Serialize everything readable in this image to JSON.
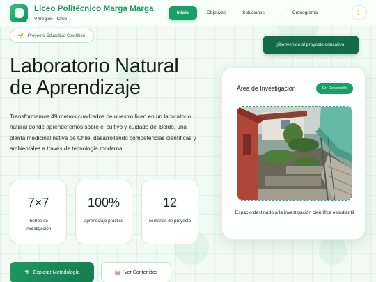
{
  "brand": {
    "title": "Liceo Politécnico Marga Marga",
    "subtitle": "V Región - Chile"
  },
  "nav": {
    "items": [
      "Inicio",
      "Objetivos",
      "Soluciones",
      "Cronograma"
    ],
    "active": "Inicio"
  },
  "theme_toggle_icon": "moon-icon",
  "badge": {
    "label": "Proyecto Educativo Científico",
    "icon": "sprout-icon"
  },
  "welcome": {
    "label": "¡Bienvenido al proyecto educativo!"
  },
  "hero": {
    "title_line1": "Laboratorio Natural",
    "title_line2": "de Aprendizaje",
    "description": "Transformamos 49 metros cuadrados de nuestro liceo en un laboratorio natural donde aprenderemos sobre el cultivo y cuidado del Boldo, una planta medicinal nativa de Chile, desarrollando competencias científicas y ambientales a través de tecnología moderna."
  },
  "stats": [
    {
      "value": "7×7",
      "label": "metros de investigación"
    },
    {
      "value": "100%",
      "label": "aprendizaje práctico"
    },
    {
      "value": "12",
      "label": "semanas de proyecto"
    }
  ],
  "buttons": {
    "explore": "Explorar Metodología",
    "contents": "Ver Contenidos"
  },
  "card": {
    "title": "Área de Investigación",
    "status": "En Desarrollo",
    "caption": "Espacio destinado a la investigación científica estudiantil"
  },
  "colors": {
    "accent": "#1b9e62",
    "dark_green": "#136b47",
    "background": "#f1faf5"
  }
}
